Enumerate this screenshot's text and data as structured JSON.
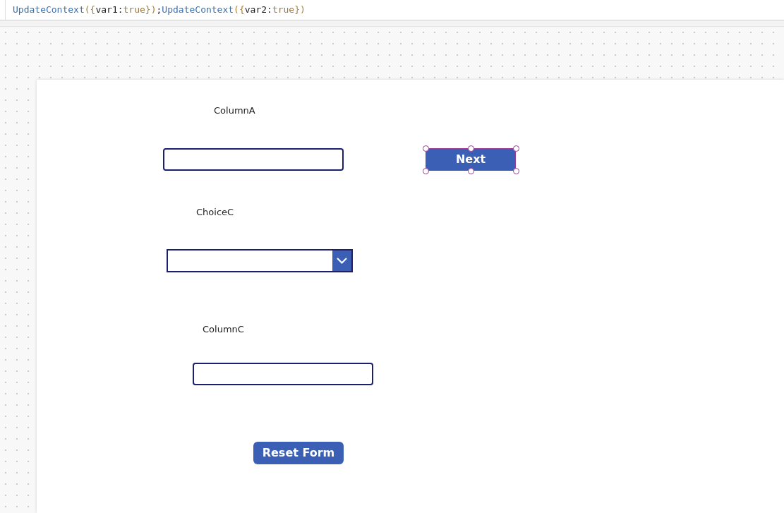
{
  "formula_bar": {
    "tokens": [
      {
        "text": "UpdateContext",
        "kind": "function"
      },
      {
        "text": "({",
        "kind": "punct"
      },
      {
        "text": "var1",
        "kind": "name"
      },
      {
        "text": ":",
        "kind": "plain"
      },
      {
        "text": "true",
        "kind": "keyword"
      },
      {
        "text": "})",
        "kind": "punct"
      },
      {
        "text": ";",
        "kind": "plain"
      },
      {
        "text": "UpdateContext",
        "kind": "function"
      },
      {
        "text": "({",
        "kind": "punct"
      },
      {
        "text": "var2",
        "kind": "name"
      },
      {
        "text": ":",
        "kind": "plain"
      },
      {
        "text": "true",
        "kind": "keyword"
      },
      {
        "text": "})",
        "kind": "punct"
      }
    ]
  },
  "screen": {
    "controls": [
      {
        "kind": "label",
        "text": "ColumnA"
      },
      {
        "kind": "input",
        "selected": false
      },
      {
        "kind": "button",
        "text": "Next",
        "selected": true
      },
      {
        "kind": "label",
        "text": "ChoiceC"
      },
      {
        "kind": "dropdown",
        "selected": false
      },
      {
        "kind": "label",
        "text": "ColumnC"
      },
      {
        "kind": "input",
        "selected": false
      },
      {
        "kind": "button",
        "text": "Reset Form",
        "selected": false
      }
    ]
  }
}
